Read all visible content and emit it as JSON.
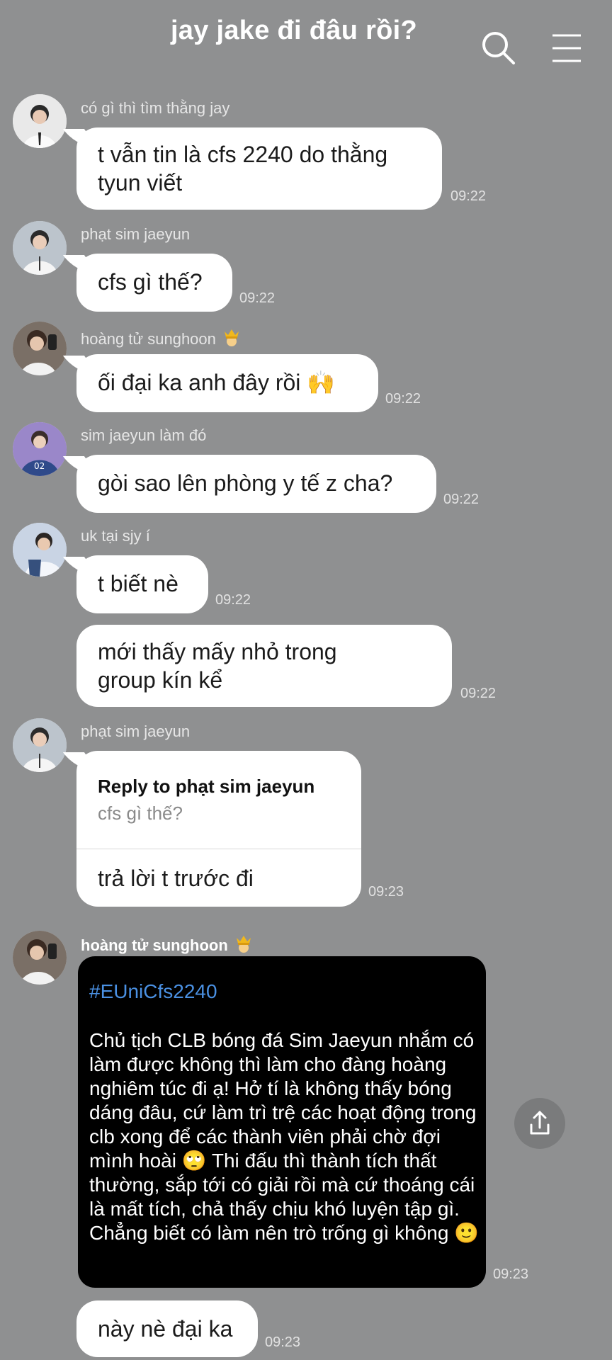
{
  "header": {
    "title": "jay jake đi đâu rồi?",
    "search_icon": "search-icon",
    "menu_icon": "hamburger-menu-icon"
  },
  "messages": [
    {
      "sender": "có gì thì tìm thằng jay",
      "text": "t vẫn tin là cfs 2240 do thằng tyun viết",
      "time": "09:22"
    },
    {
      "sender": "phạt sim jaeyun",
      "text": "cfs gì thế?",
      "time": "09:22"
    },
    {
      "sender": "hoàng tử sunghoon",
      "text": "ối đại ka anh đây rồi 🙌",
      "time": "09:22"
    },
    {
      "sender": "sim jaeyun làm đó",
      "text": "gòi sao lên phòng y tế z cha?",
      "time": "09:22"
    },
    {
      "sender": "uk tại sjy í",
      "text": "t biết nè",
      "time": "09:22"
    },
    {
      "text": "mới thấy mấy nhỏ trong group kín kể",
      "time": "09:22"
    },
    {
      "sender": "phạt sim jaeyun",
      "reply_label": "Reply to phạt sim jaeyun",
      "reply_quote": "cfs gì thế?",
      "text": "trả lời t trước đi",
      "time": "09:23"
    },
    {
      "sender": "hoàng tử sunghoon",
      "card_tag": "#EUniCfs2240",
      "card_text": "Chủ tịch CLB bóng đá Sim Jaeyun nhắm có làm được không thì làm cho đàng hoàng nghiêm túc đi ạ! Hở tí là không thấy bóng dáng đâu, cứ làm trì trệ các hoạt động trong clb xong để các thành viên phải chờ đợi mình hoài 🙄 Thi đấu thì thành tích thất thường, sắp tới có giải rồi mà cứ thoáng cái là mất tích, chả thấy chịu khó luyện tập gì. Chẳng biết có làm nên trò trống gì không 🙂",
      "time": "09:23"
    },
    {
      "text": "này nè đại ka",
      "time": "09:23"
    }
  ],
  "icons": {
    "crown": "crown-emoji-icon",
    "share": "share-upload-icon"
  },
  "colors": {
    "background": "#8f9091",
    "bubble": "#ffffff",
    "card": "#000000",
    "hashtag": "#4a90e2"
  }
}
